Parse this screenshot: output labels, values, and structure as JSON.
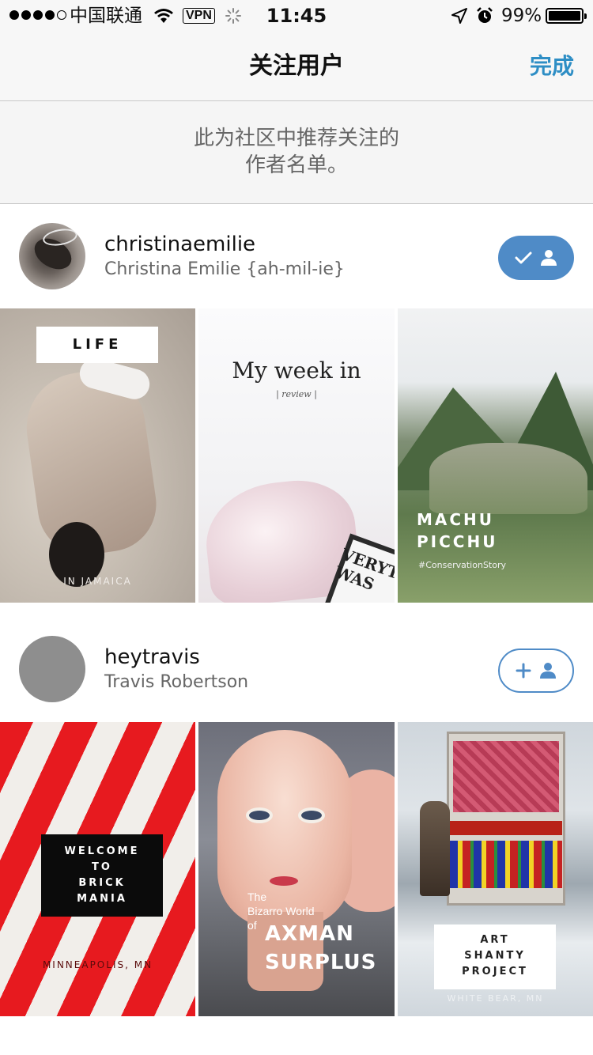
{
  "status_bar": {
    "carrier": "中国联通",
    "vpn": "VPN",
    "time": "11:45",
    "battery_percent": "99%",
    "battery_level": 0.99
  },
  "nav": {
    "title": "关注用户",
    "done": "完成"
  },
  "intro": {
    "line1": "此为社区中推荐关注的",
    "line2": "作者名单。"
  },
  "users": [
    {
      "username": "christinaemilie",
      "display_name": "Christina Emilie {ah-mil-ie}",
      "following": true,
      "stories": [
        {
          "label": "LIFE",
          "subtitle": "IN JAMAICA"
        },
        {
          "label": "My week in",
          "subtitle": "| review |",
          "extra": "VERYTHIN WAS"
        },
        {
          "label_line1": "MACHU",
          "label_line2": "PICCHU",
          "subtitle": "#ConservationStory"
        }
      ]
    },
    {
      "username": "heytravis",
      "display_name": "Travis Robertson",
      "following": false,
      "stories": [
        {
          "label_lines": [
            "WELCOME",
            "TO",
            "BRICK",
            "MANIA"
          ],
          "subtitle": "MINNEAPOLIS, MN"
        },
        {
          "small_lines": [
            "The",
            "Bizarro World",
            "of"
          ],
          "big_lines": [
            "AXMAN",
            "SURPLUS"
          ]
        },
        {
          "label_lines": [
            "ART",
            "SHANTY",
            "PROJECT"
          ],
          "subtitle": "WHITE BEAR, MN"
        }
      ]
    }
  ],
  "colors": {
    "accent": "#2e8ec5",
    "follow_button": "#4f8bc7",
    "subtitle_text": "#666666",
    "placeholder_avatar": "#8e8e8e"
  },
  "icons": {
    "following": "check-person-icon",
    "follow": "plus-person-icon"
  }
}
